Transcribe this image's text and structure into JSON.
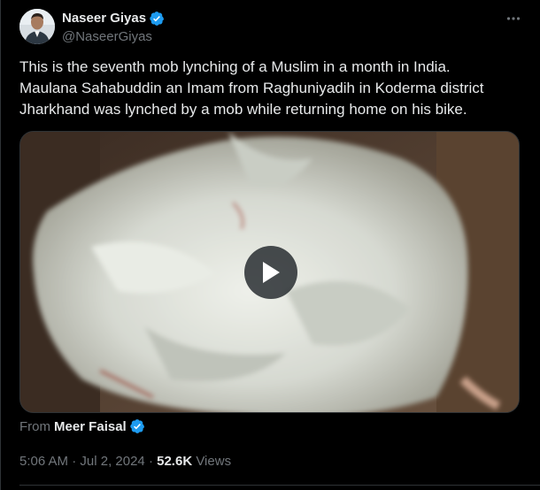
{
  "author": {
    "display_name": "Naseer Giyas",
    "handle": "@NaseerGiyas",
    "verified": true
  },
  "more_icon": "more-horizontal-icon",
  "tweet": {
    "lines": [
      "This is the seventh mob lynching of a Muslim in a month in India.",
      "Maulana Sahabuddin an Imam from Raghuniyadih in Koderma district",
      "Jharkhand was lynched by a mob while returning home on his bike."
    ]
  },
  "media": {
    "type": "video",
    "play_icon": "play-icon"
  },
  "attribution": {
    "from_label": "From",
    "source_name": "Meer Faisal",
    "verified": true
  },
  "meta": {
    "time": "5:06 AM",
    "separator": " · ",
    "date": "Jul 2, 2024",
    "views_count": "52.6K",
    "views_label": "Views"
  },
  "colors": {
    "background": "#000000",
    "text": "#e7e9ea",
    "muted": "#71767b",
    "verified_blue": "#1d9bf0",
    "border": "#2f3336"
  }
}
